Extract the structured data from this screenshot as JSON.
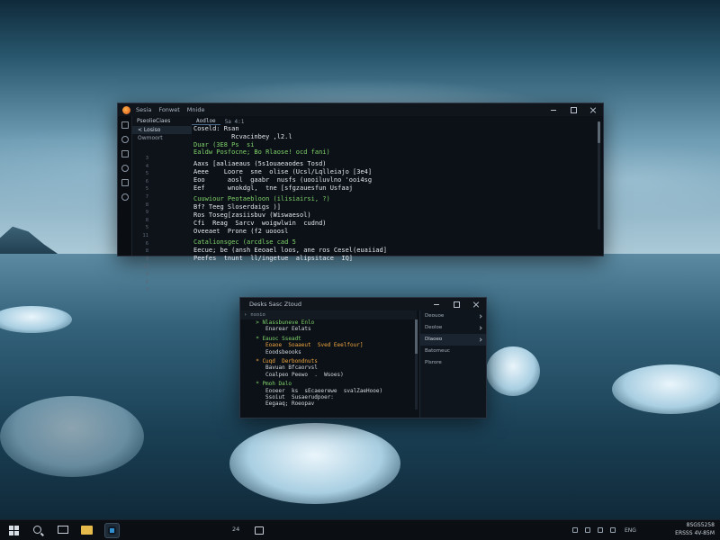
{
  "editor": {
    "menu": [
      "Sesia",
      "Fonwet",
      "Mnide"
    ],
    "explorer": {
      "title": "PseolieCiaes",
      "items": [
        "< Losiso",
        "Owmoort"
      ]
    },
    "tabs": [
      "Aodloe",
      "5a 4:1"
    ],
    "line_numbers": [
      "3",
      "4",
      "5",
      "6",
      "5",
      "7",
      "8",
      "9",
      "8",
      "5",
      "11",
      "6",
      "8",
      "9",
      "12",
      "9",
      "6",
      "4"
    ],
    "code_lines": [
      {
        "text": "Coseld: Rsan",
        "color": "white"
      },
      {
        "text": "          Rcvacinbey ,l2.l",
        "color": "white"
      },
      {
        "text": "Duar (3E8 Ps  si",
        "color": "green"
      },
      {
        "text": "Ealdw Posfocne; Bo Rlaose! ocd fani)",
        "color": "green"
      },
      {
        "text": "",
        "color": "spacer"
      },
      {
        "text": "Aaxs [aaliaeaus (5s1ouaeaodes Tosd)",
        "color": "white"
      },
      {
        "text": "Aeee    Loore  sne  olise (Ucsl/Lqlleiajo [3e4]",
        "color": "white"
      },
      {
        "text": "Eoo      aosl  gaabr  nusfs (uooiluvlno 'ooi4sg",
        "color": "white"
      },
      {
        "text": "Eef      wnokdgl,  tne [sfgzauesfun Usfaaj",
        "color": "white"
      },
      {
        "text": "",
        "color": "spacer"
      },
      {
        "text": "Cuuwiour Peotaebloon (ilisiairsi, ?)",
        "color": "green"
      },
      {
        "text": "Bf? Teeg Sloserdaigs )]",
        "color": "white"
      },
      {
        "text": "Ros Toseg[zasiisbuv (Wiswaesol)",
        "color": "white"
      },
      {
        "text": "Cfi  Reag  Sarcv  woigwlwin  cudnd)",
        "color": "white"
      },
      {
        "text": "Oveeaet  Prone (f2 uooosl",
        "color": "white"
      },
      {
        "text": "",
        "color": "spacer"
      },
      {
        "text": "Catalionsgec (arcdlse cad 5",
        "color": "green"
      },
      {
        "text": "Eecue; be (ansh Eeoael loos, ane ros Cesel(euaiiad]",
        "color": "white"
      },
      {
        "text": "Peefes  tnunt  ll/ingetue  alipsitace  IQ]",
        "color": "white"
      }
    ]
  },
  "tree_window": {
    "title": "Desks Sasc Ztoud",
    "subbar_label": "nsoio",
    "lines": [
      {
        "text": "  > Nlassbuneve Enlo",
        "color": "green"
      },
      {
        "text": "     Enarear Eelats",
        "color": "white"
      },
      {
        "text": "",
        "color": "gap"
      },
      {
        "text": "  * Eauoc Sseadt",
        "color": "green"
      },
      {
        "text": "     Eoaoe  Soaaeut  Sved Eeelfour]",
        "color": "orange"
      },
      {
        "text": "     Eoodsbeooks",
        "color": "white"
      },
      {
        "text": "",
        "color": "gap"
      },
      {
        "text": "  * Cuqd  Derbondnuts",
        "color": "orange"
      },
      {
        "text": "     Bavuan Bfcaorvsl",
        "color": "white"
      },
      {
        "text": "     Coalpeo Peewo  .  Wsoes)",
        "color": "white"
      },
      {
        "text": "",
        "color": "gap"
      },
      {
        "text": "  * Pmoh Dalo",
        "color": "green"
      },
      {
        "text": "     Eooeer  ks  sEcaeerewe  svalZaeHooe)",
        "color": "white"
      },
      {
        "text": "     Ssoiut  Susaerudpoer:",
        "color": "white"
      },
      {
        "text": "     Eegaaq; Roeopav",
        "color": "white"
      }
    ],
    "side_items": [
      {
        "label": "Deouoe",
        "chevron": true
      },
      {
        "label": "Deoloe",
        "chevron": true
      },
      {
        "label": "Dlaoeo",
        "chevron": true,
        "active": true
      },
      {
        "label": "Batomeuc",
        "chevron": false
      },
      {
        "label": "Plsrore",
        "chevron": false
      }
    ]
  },
  "taskbar": {
    "center_label": "24",
    "tray_text": "ENG",
    "clock_time": "8SGS5258",
    "clock_date": "ERSSS 4V-85M"
  },
  "colors": {
    "green": "#7fd36a",
    "orange": "#f0a640",
    "white": "#e3e7ec",
    "window_bg": "#0c1117",
    "taskbar_bg": "#0b0f14"
  }
}
